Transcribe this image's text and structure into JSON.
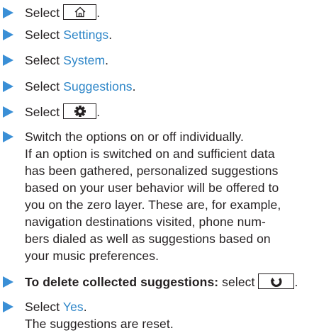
{
  "steps": [
    {
      "prefix": "Select",
      "button": "home-icon",
      "suffix": "."
    },
    {
      "prefix": "Select",
      "link": "Settings",
      "suffix": "."
    },
    {
      "prefix": "Select",
      "link": "System",
      "suffix": "."
    },
    {
      "prefix": "Select",
      "link": "Suggestions",
      "suffix": "."
    },
    {
      "prefix": "Select",
      "button": "gear-icon",
      "suffix": "."
    },
    {
      "lines": [
        "Switch the options on or off individually.",
        "If an option is switched on and sufficient data",
        "has been gathered, personalized suggestions",
        "based on your user behavior will be offered to",
        "you on the zero layer. These are, for example,",
        "navigation destinations visited, phone num-",
        "bers dialed as well as suggestions based on",
        "your music preferences."
      ]
    },
    {
      "bold": "To delete collected suggestions:",
      "prefix": "select",
      "button": "reset-icon",
      "suffix": "."
    },
    {
      "prefix": "Select",
      "link": "Yes",
      "suffix": "."
    }
  ],
  "result": "The suggestions are reset.",
  "colors": {
    "arrow": "#3a8fd6",
    "link": "#2e86c8",
    "text": "#231f20"
  }
}
